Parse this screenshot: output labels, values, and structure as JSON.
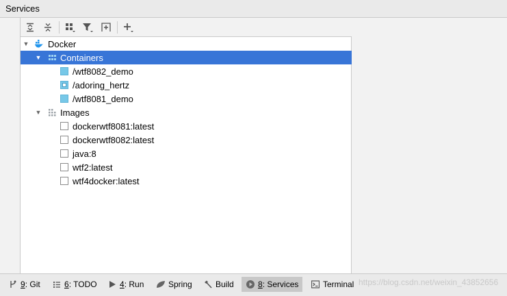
{
  "window": {
    "title": "Services"
  },
  "toolbar": {
    "buttons": [
      {
        "icon": "expand-all-icon",
        "dropdown": false
      },
      {
        "icon": "collapse-all-icon",
        "dropdown": false
      },
      {
        "icon": "group-by-icon",
        "dropdown": true
      },
      {
        "icon": "filter-icon",
        "dropdown": true
      },
      {
        "icon": "new-tab-icon",
        "dropdown": false
      },
      {
        "icon": "add-icon",
        "dropdown": true
      }
    ]
  },
  "tree": {
    "root": {
      "label": "Docker",
      "icon": "docker-icon",
      "expanded": true
    },
    "groups": [
      {
        "label": "Containers",
        "icon": "containers-icon",
        "expanded": true,
        "selected": true,
        "items": [
          {
            "label": "/wtf8082_demo",
            "state": "running"
          },
          {
            "label": "/adoring_hertz",
            "state": "paused"
          },
          {
            "label": "/wtf8081_demo",
            "state": "running"
          }
        ]
      },
      {
        "label": "Images",
        "icon": "images-icon",
        "expanded": true,
        "selected": false,
        "items": [
          {
            "label": "dockerwtf8081:latest",
            "state": "image"
          },
          {
            "label": "dockerwtf8082:latest",
            "state": "image"
          },
          {
            "label": "java:8",
            "state": "image"
          },
          {
            "label": "wtf2:latest",
            "state": "image"
          },
          {
            "label": "wtf4docker:latest",
            "state": "image"
          }
        ]
      }
    ]
  },
  "tool_windows": [
    {
      "number": "9",
      "label": ": Git",
      "icon": "git-icon",
      "active": false
    },
    {
      "number": "6",
      "label": ": TODO",
      "icon": "todo-icon",
      "active": false
    },
    {
      "number": "4",
      "label": ": Run",
      "icon": "run-icon",
      "active": false
    },
    {
      "number": "",
      "label": "Spring",
      "icon": "spring-icon",
      "active": false
    },
    {
      "number": "",
      "label": "Build",
      "icon": "build-icon",
      "active": false
    },
    {
      "number": "8",
      "label": ": Services",
      "icon": "services-icon",
      "active": true
    },
    {
      "number": "",
      "label": "Terminal",
      "icon": "terminal-icon",
      "active": false
    }
  ],
  "watermark": "https://blog.csdn.net/weixin_43852656",
  "colors": {
    "selection": "#3875d7",
    "container_running": "#77c8e8",
    "docker_blue": "#2396ed"
  }
}
